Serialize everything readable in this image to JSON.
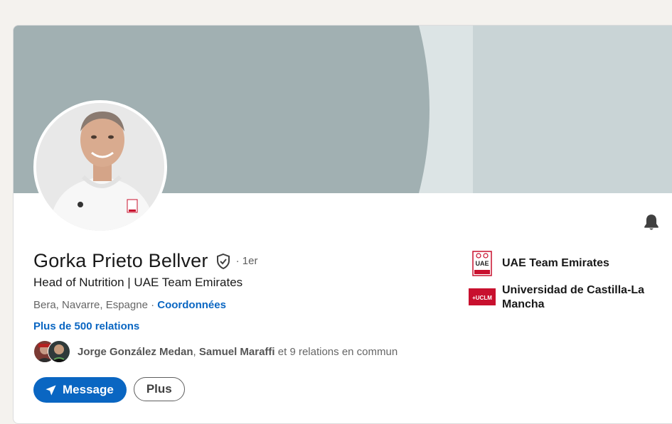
{
  "profile": {
    "name": "Gorka Prieto Bellver",
    "degree": "· 1er",
    "headline": "Head of Nutrition | UAE Team Emirates",
    "location": "Bera, Navarre, Espagne ·",
    "contact_link": "Coordonnées",
    "relations": "Plus de 500 relations",
    "mutual": {
      "name1": "Jorge González Medan",
      "separator": ", ",
      "name2": "Samuel Maraffi",
      "rest": " et 9 relations en commun"
    }
  },
  "actions": {
    "message_label": "Message",
    "more_label": "Plus"
  },
  "experience": [
    {
      "name": "UAE Team Emirates",
      "logo_text": "UAE"
    },
    {
      "name": "Universidad de Castilla-La Mancha",
      "logo_text": "+UCLM"
    }
  ],
  "icons": [
    "bell-icon",
    "verified-shield-icon",
    "send-icon"
  ],
  "colors": {
    "link_blue": "#0a66c2",
    "banner_dark": "#a1b0b2",
    "banner_light": "#dce4e5",
    "banner_mid": "#c9d4d6",
    "uclm_red": "#c8102e"
  }
}
